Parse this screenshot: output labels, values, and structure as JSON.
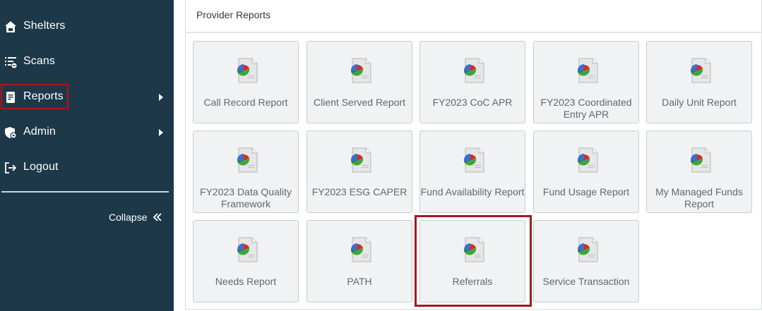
{
  "sidebar": {
    "items": [
      {
        "label": "Shelters",
        "icon": "home-icon",
        "has_submenu": false
      },
      {
        "label": "Scans",
        "icon": "scan-list-icon",
        "has_submenu": false
      },
      {
        "label": "Reports",
        "icon": "report-icon",
        "has_submenu": true
      },
      {
        "label": "Admin",
        "icon": "admin-shield-icon",
        "has_submenu": true
      },
      {
        "label": "Logout",
        "icon": "logout-icon",
        "has_submenu": false
      }
    ],
    "collapse_label": "Collapse"
  },
  "main": {
    "title": "Provider Reports",
    "reports": [
      {
        "label": "Call Record Report"
      },
      {
        "label": "Client Served Report"
      },
      {
        "label": "FY2023 CoC APR"
      },
      {
        "label": "FY2023 Coordinated Entry APR"
      },
      {
        "label": "Daily Unit Report"
      },
      {
        "label": "FY2023 Data Quality Framework"
      },
      {
        "label": "FY2023 ESG CAPER"
      },
      {
        "label": "Fund Availability Report"
      },
      {
        "label": "Fund Usage Report"
      },
      {
        "label": "My Managed Funds Report"
      },
      {
        "label": "Needs Report"
      },
      {
        "label": "PATH"
      },
      {
        "label": "Referrals"
      },
      {
        "label": "Service Transaction"
      }
    ]
  },
  "colors": {
    "sidebar_bg": "#1d3849",
    "highlight": "#b3111b",
    "tile_bg": "#f1f2f3",
    "tile_text": "#5d6a72"
  }
}
